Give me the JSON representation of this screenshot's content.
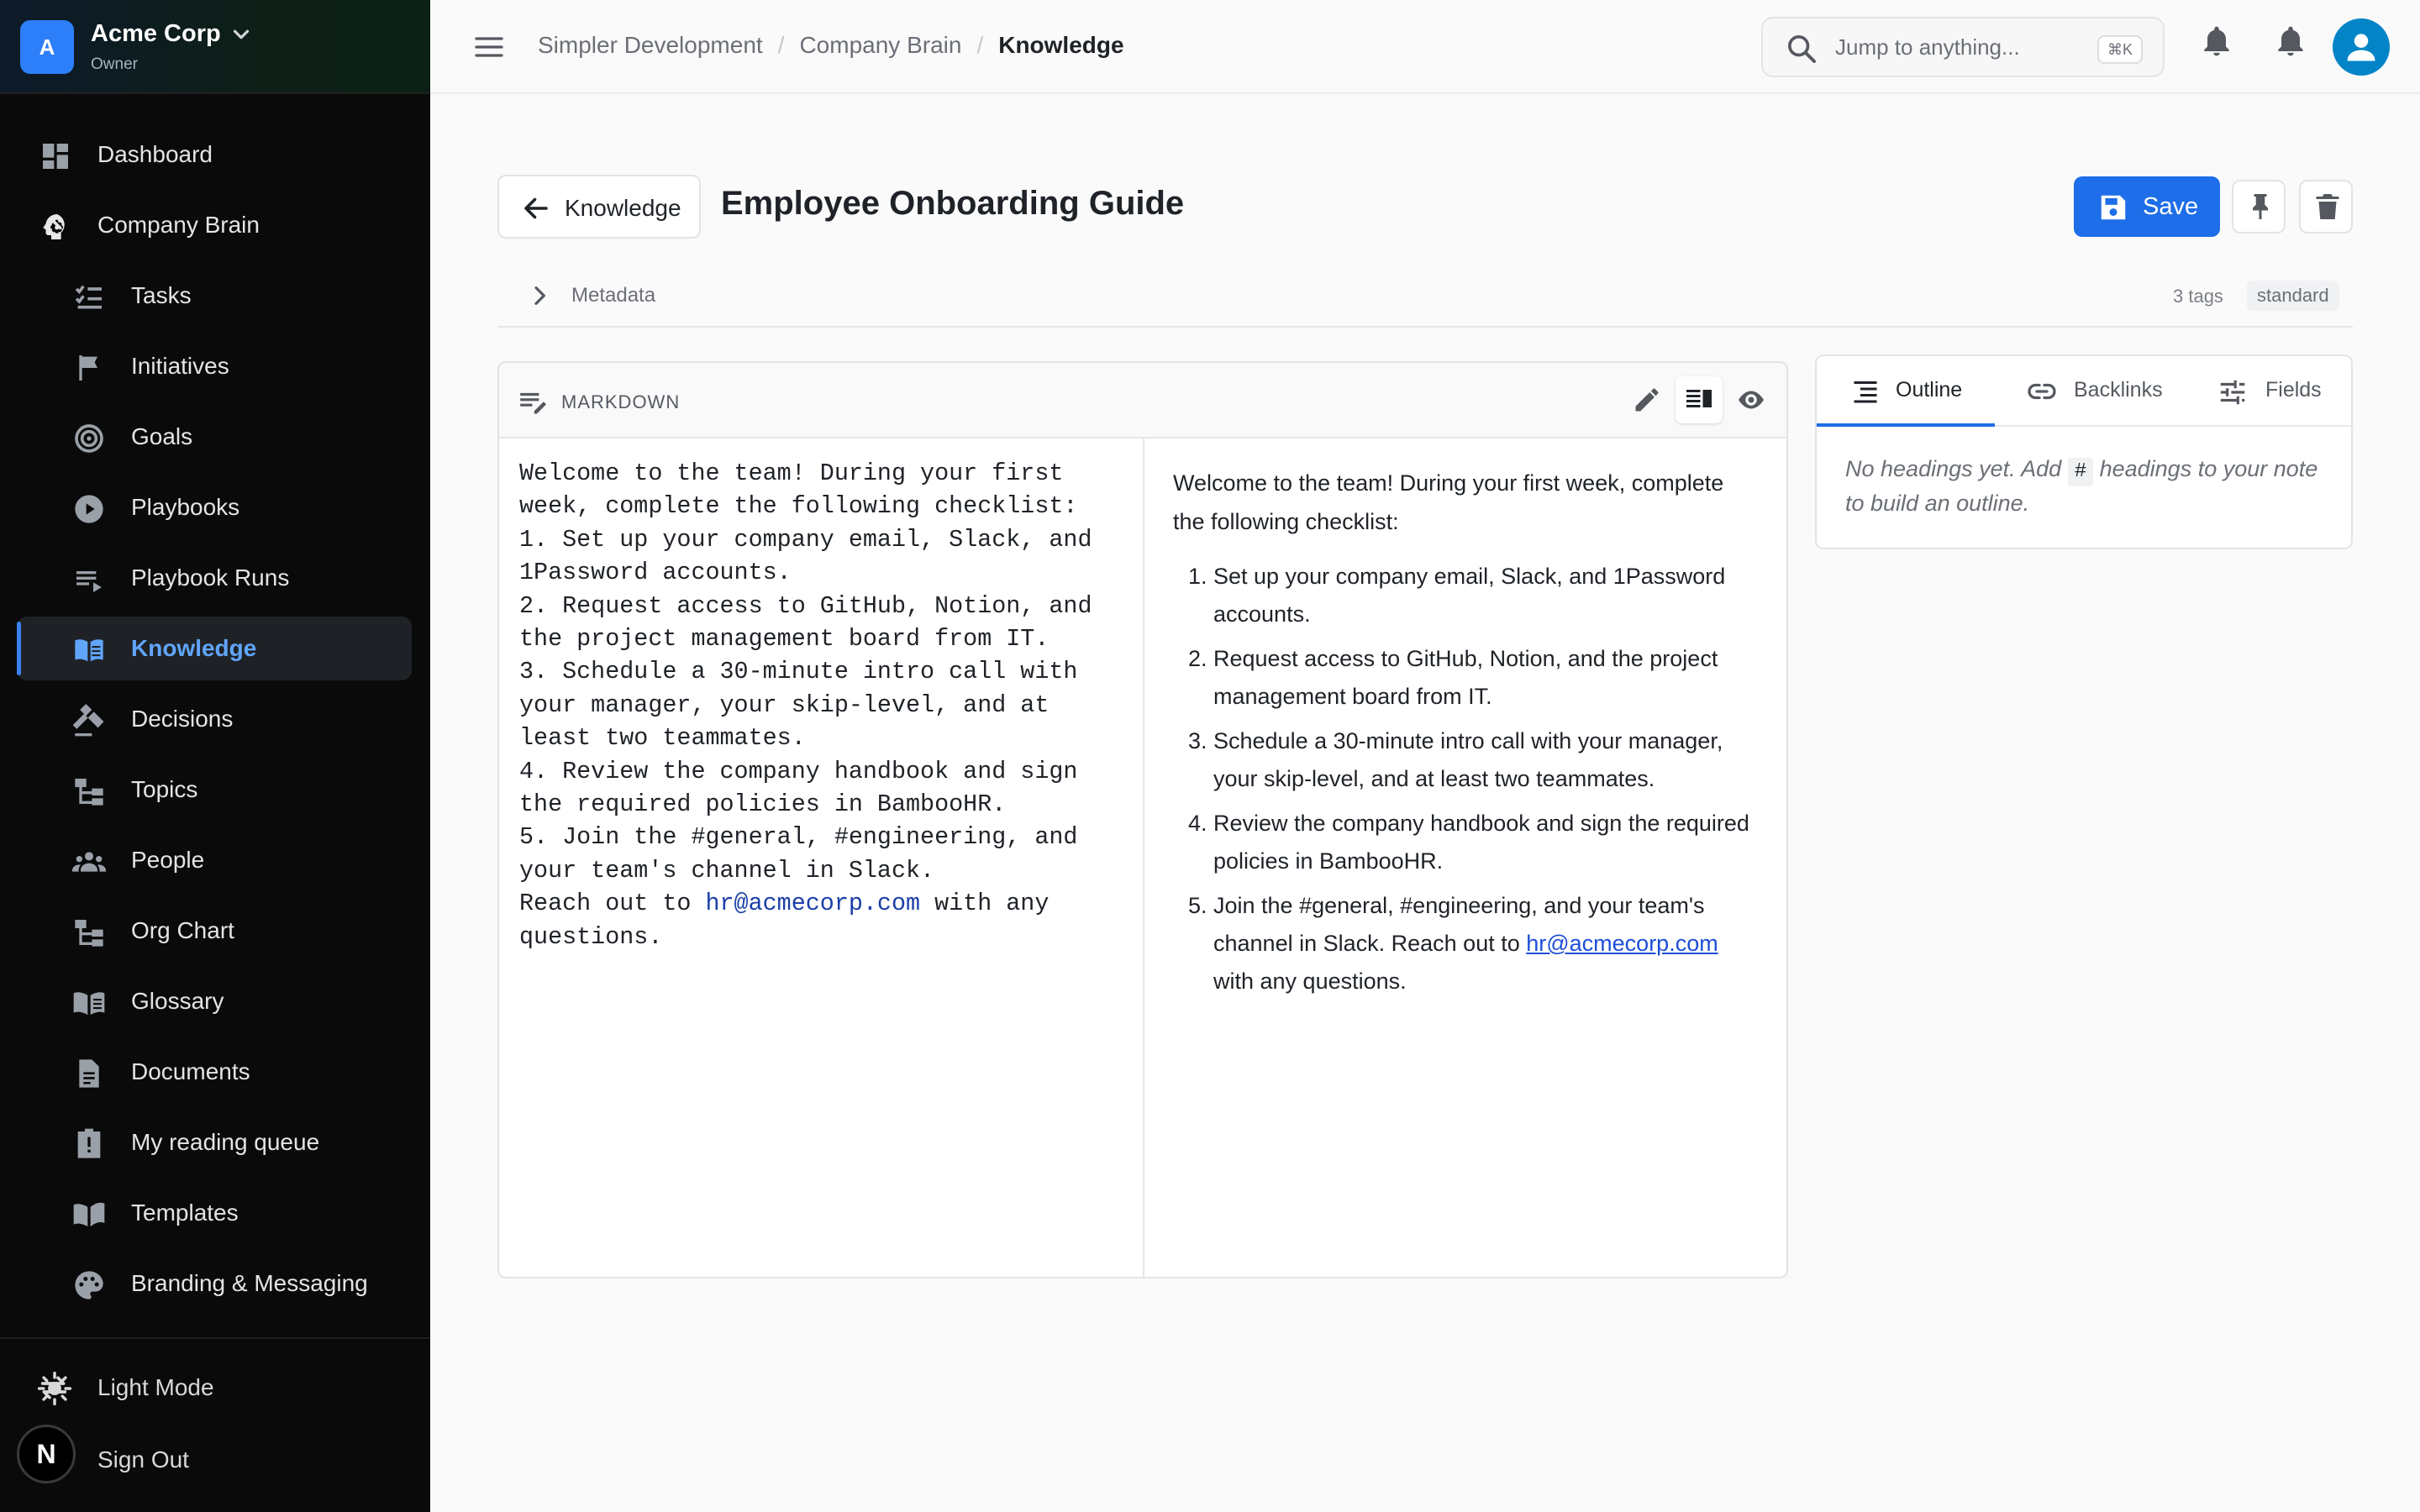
{
  "org": {
    "avatar_letter": "A",
    "name": "Acme Corp",
    "role": "Owner"
  },
  "sidebar": {
    "items": [
      {
        "label": "Dashboard",
        "icon": "dashboard-icon"
      },
      {
        "label": "Company Brain",
        "icon": "brain-icon"
      },
      {
        "label": "Tasks",
        "icon": "checklist-icon"
      },
      {
        "label": "Initiatives",
        "icon": "flag-icon"
      },
      {
        "label": "Goals",
        "icon": "target-icon"
      },
      {
        "label": "Playbooks",
        "icon": "play-circle-icon"
      },
      {
        "label": "Playbook Runs",
        "icon": "playlist-icon"
      },
      {
        "label": "Knowledge",
        "icon": "book-open-icon",
        "active": true
      },
      {
        "label": "Decisions",
        "icon": "gavel-icon"
      },
      {
        "label": "Topics",
        "icon": "hierarchy-icon"
      },
      {
        "label": "People",
        "icon": "people-icon"
      },
      {
        "label": "Org Chart",
        "icon": "org-chart-icon"
      },
      {
        "label": "Glossary",
        "icon": "glossary-book-icon"
      },
      {
        "label": "Documents",
        "icon": "document-icon"
      },
      {
        "label": "My reading queue",
        "icon": "alert-clipboard-icon"
      },
      {
        "label": "Templates",
        "icon": "templates-icon"
      },
      {
        "label": "Branding & Messaging",
        "icon": "palette-icon"
      }
    ],
    "light_mode_label": "Light Mode",
    "sign_out_label": "Sign Out",
    "next_badge": "N"
  },
  "breadcrumb": {
    "items": [
      "Simpler Development",
      "Company Brain"
    ],
    "current": "Knowledge"
  },
  "search": {
    "placeholder": "Jump to anything...",
    "shortcut": "⌘K"
  },
  "page": {
    "back_label": "Knowledge",
    "title": "Employee Onboarding Guide",
    "save_label": "Save",
    "metadata_label": "Metadata",
    "tags_count": "3 tags",
    "tier": "standard"
  },
  "editor": {
    "mode_label": "MARKDOWN",
    "source_before_link": "Welcome to the team! During your first week, complete the following checklist:\n1. Set up your company email, Slack, and 1Password accounts.\n2. Request access to GitHub, Notion, and the project management board from IT.\n3. Schedule a 30-minute intro call with your manager, your skip-level, and at least two teammates.\n4. Review the company handbook and sign the required policies in BambooHR.\n5. Join the #general, #engineering, and your team's channel in Slack.\nReach out to ",
    "source_link": "hr@acmecorp.com",
    "source_after_link": " with any questions.",
    "preview": {
      "intro": "Welcome to the team! During your first week, complete the following checklist:",
      "items": [
        "Set up your company email, Slack, and 1Password accounts.",
        "Request access to GitHub, Notion, and the project management board from IT.",
        "Schedule a 30-minute intro call with your manager, your skip-level, and at least two teammates.",
        "Review the company handbook and sign the required policies in BambooHR."
      ],
      "last_item_before_link": "Join the #general, #engineering, and your team's channel in Slack. Reach out to ",
      "last_item_link": "hr@acmecorp.com",
      "last_item_after_link": " with any questions."
    }
  },
  "side_panel": {
    "tabs": [
      "Outline",
      "Backlinks",
      "Fields"
    ],
    "empty_before": "No headings yet. Add ",
    "empty_code": "#",
    "empty_after": " headings to your note to build an outline."
  },
  "colors": {
    "accent": "#1d6ee8",
    "active_nav": "#60a5fa",
    "sidebar_bg": "#0a0a0a"
  }
}
